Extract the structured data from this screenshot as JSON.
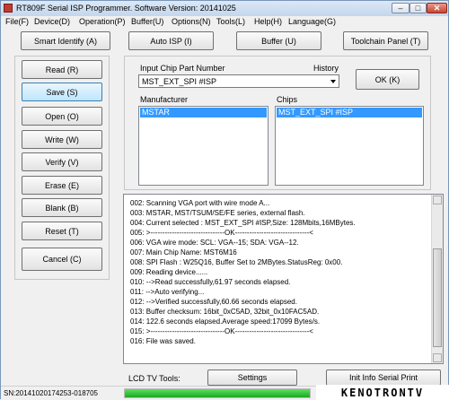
{
  "window": {
    "title": "RT809F Serial ISP Programmer. Software Version: 20141025",
    "controls": {
      "minimize": "–",
      "maximize": "□",
      "close": "✕"
    }
  },
  "menu": [
    "File(F)",
    "Device(D)",
    "Operation(P)",
    "Buffer(U)",
    "Options(N)",
    "Tools(L)",
    "Help(H)",
    "Language(G)"
  ],
  "toolbar": {
    "smart_identify": "Smart Identify (A)",
    "auto_isp": "Auto ISP (I)",
    "buffer": "Buffer (U)",
    "toolchain_panel": "Toolchain Panel (T)"
  },
  "actions": [
    "Read (R)",
    "Save (S)",
    "Open (O)",
    "Write  (W)",
    "Verify (V)",
    "Erase (E)",
    "Blank (B)",
    "Reset  (T)"
  ],
  "cancel_button": "Cancel (C)",
  "chip": {
    "input_label": "Input Chip Part Number",
    "history_label": "History",
    "input_value": "MST_EXT_SPI #ISP",
    "ok_button": "OK (K)",
    "manufacturer_label": "Manufacturer",
    "manufacturer_selected": "MSTAR",
    "chips_label": "Chips",
    "chips_selected": "MST_EXT_SPI #ISP"
  },
  "log": [
    "002:  Scanning VGA port with wire mode A...",
    "003:  MSTAR, MST/TSUM/SE/FE series, external flash.",
    "004:  Current selected : MST_EXT_SPI #ISP,Size: 128Mbits,16MBytes.",
    "005:  >-------------------------------OK-------------------------------<",
    "006:  VGA wire mode: SCL: VGA--15; SDA: VGA--12.",
    "007:  Main Chip Name: MST6M16",
    "008:  SPI Flash : W25Q16, Buffer Set to 2MBytes.StatusReg: 0x00.",
    "009:  Reading device......",
    "010:  -->Read successfully,61.97 seconds elapsed.",
    "011:  -->Auto verifying...",
    "012:  -->Verified successfully,60.66 seconds elapsed.",
    "013:  Buffer checksum: 16bit_0xC5AD, 32bit_0x10FAC5AD.",
    "014:  122.6 seconds elapsed.Average speed:17099 Bytes/s.",
    "015:  >-------------------------------OK-------------------------------<",
    "016:  File was saved."
  ],
  "lcd_tools": {
    "label": "LCD TV Tools:",
    "settings": "Settings",
    "init_info": "Init Info Serial Print"
  },
  "status": {
    "sn": "SN:20141020174253-018705",
    "progress_fraction": 1.0
  },
  "watermark": "KENOTRONTV",
  "colors": {
    "selection": "#3399ff",
    "progress": "#1ba81f",
    "title_icon": "#c23b2f"
  }
}
